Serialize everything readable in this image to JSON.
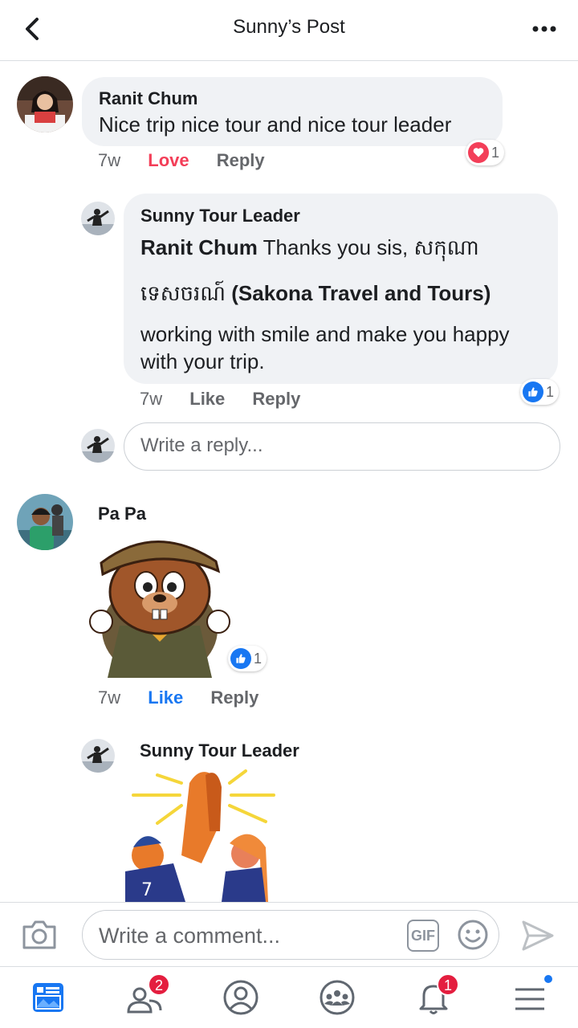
{
  "header": {
    "title": "Sunny’s Post"
  },
  "comments": [
    {
      "author": "Ranit Chum",
      "text": "Nice trip nice tour and nice tour leader",
      "time": "7w",
      "reaction_action": "Love",
      "reply_action": "Reply",
      "reaction_count": "1"
    },
    {
      "author": "Sunny Tour Leader",
      "mention": "Ranit Chum",
      "line1": " Thanks you sis, សកុណា",
      "line2_khmer": "ទេសចរណ៍",
      "line2_bold": " (Sakona Travel and Tours)",
      "line3": "working with smile and make you happy with your trip.",
      "time": "7w",
      "like_action": "Like",
      "reply_action": "Reply",
      "reaction_count": "1"
    },
    {
      "author": "Pa Pa",
      "time": "7w",
      "like_action": "Like",
      "reply_action": "Reply",
      "reaction_count": "1"
    },
    {
      "author": "Sunny Tour Leader"
    }
  ],
  "reply_input": {
    "placeholder": "Write a reply..."
  },
  "composer": {
    "placeholder": "Write a comment...",
    "gif_label": "GIF"
  },
  "tabbar": {
    "friends_badge": "2",
    "notifications_badge": "1"
  },
  "colors": {
    "love": "#f33e58",
    "like": "#1877f2",
    "badge": "#e41e3f"
  }
}
